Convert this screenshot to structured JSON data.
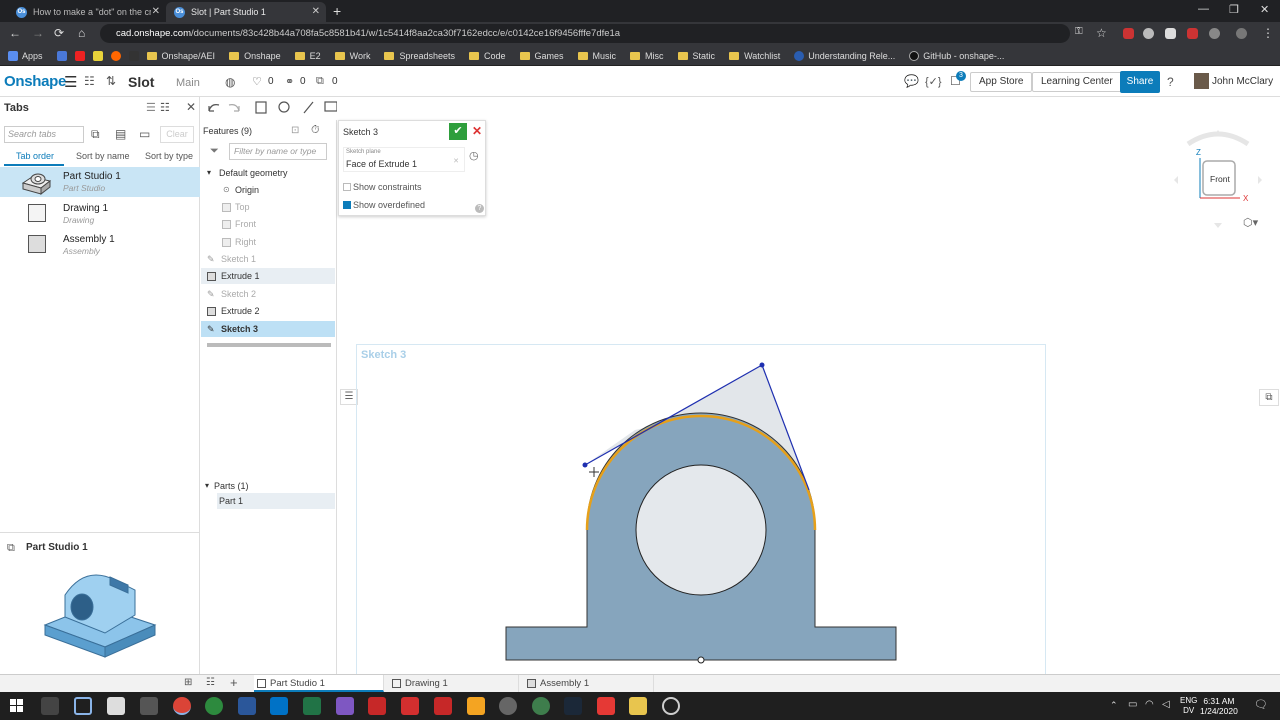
{
  "browser": {
    "tabs": [
      {
        "title": "How to make a \"dot\" on the cros",
        "active": false
      },
      {
        "title": "Slot | Part Studio 1",
        "active": true
      }
    ],
    "url_host": "cad.onshape.com",
    "url_path": "/documents/83c428b44a708fa5c8581b41/w/1c5414f8aa2ca30f7162edcc/e/c0142ce16f9456fffe7dfe1a",
    "bookmarks": [
      "Apps",
      "Onshape/AEI",
      "Onshape",
      "E2",
      "Work",
      "Spreadsheets",
      "Code",
      "Games",
      "Music",
      "Misc",
      "Static",
      "Watchlist",
      "Understanding Rele...",
      "GitHub - onshape-..."
    ]
  },
  "onshape": {
    "logo": "Onshape",
    "doc_name": "Slot",
    "workspace": "Main",
    "likes": "0",
    "links": "0",
    "copies": "0",
    "notif_count": "3",
    "app_store": "App Store",
    "learning_center": "Learning Center",
    "share": "Share",
    "user": "John McClary"
  },
  "tabs_panel": {
    "title": "Tabs",
    "search_placeholder": "Search tabs",
    "clear": "Clear",
    "sort": [
      "Tab order",
      "Sort by name",
      "Sort by type"
    ],
    "items": [
      {
        "name": "Part Studio 1",
        "type": "Part Studio"
      },
      {
        "name": "Drawing 1",
        "type": "Drawing"
      },
      {
        "name": "Assembly 1",
        "type": "Assembly"
      }
    ],
    "preview_title": "Part Studio 1"
  },
  "features": {
    "title": "Features (9)",
    "filter_placeholder": "Filter by name or type",
    "default_geometry": "Default geometry",
    "geometry": [
      "Origin",
      "Top",
      "Front",
      "Right"
    ],
    "list": [
      "Sketch 1",
      "Extrude 1",
      "Sketch 2",
      "Extrude 2",
      "Sketch 3"
    ],
    "parts_title": "Parts (1)",
    "parts": [
      "Part 1"
    ]
  },
  "sketch_dialog": {
    "title": "Sketch 3",
    "plane_label": "Sketch plane",
    "plane_value": "Face of Extrude 1",
    "show_constraints": "Show constraints",
    "show_overdefined": "Show overdefined"
  },
  "viewport": {
    "sketch_label": "Sketch 3",
    "view_cube": "Front",
    "axis_z": "Z",
    "axis_x": "X"
  },
  "bottom_tabs": [
    "Part Studio 1",
    "Drawing 1",
    "Assembly 1"
  ],
  "taskbar": {
    "lang1": "ENG",
    "lang2": "DV",
    "time": "6:31 AM",
    "date": "1/24/2020"
  }
}
